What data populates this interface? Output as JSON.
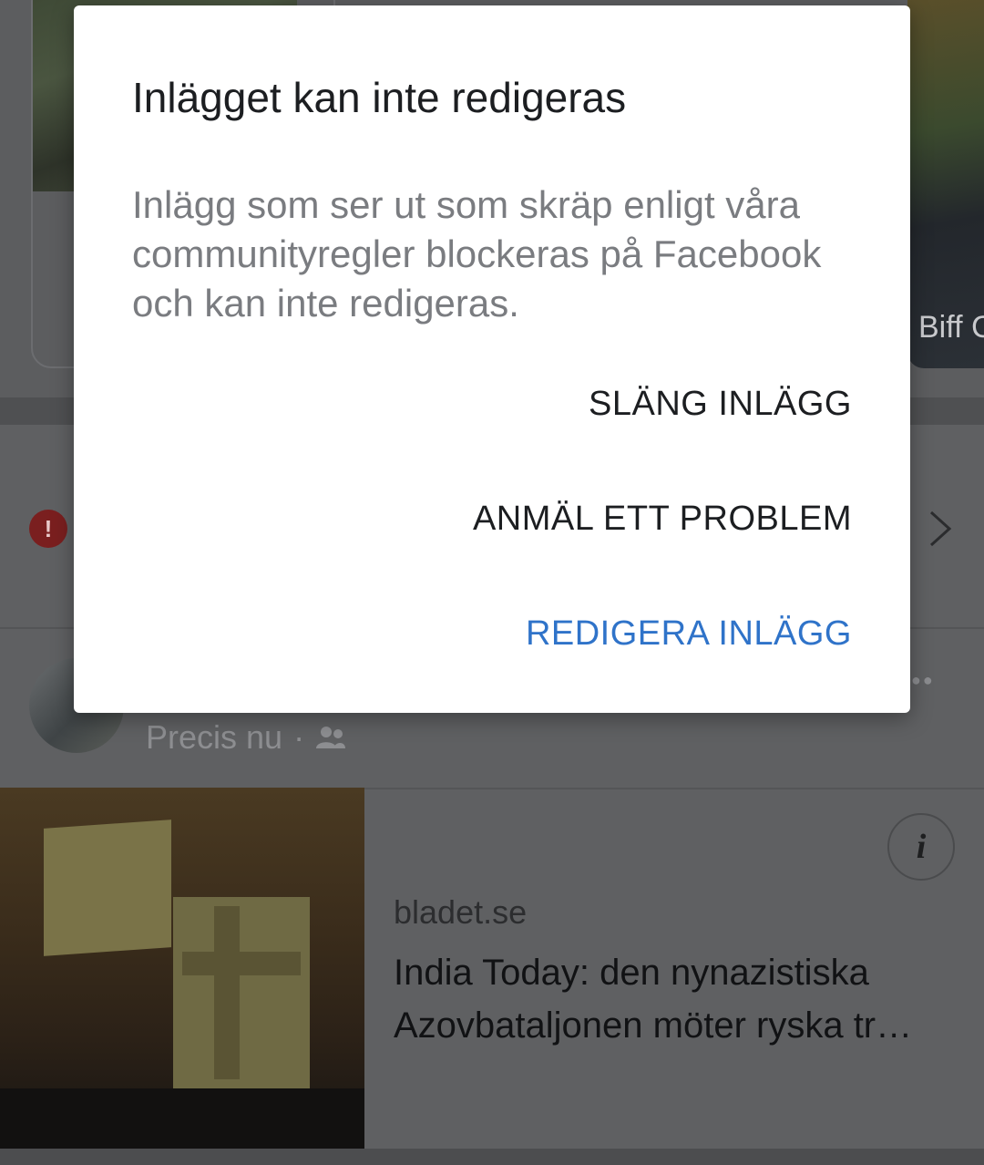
{
  "background": {
    "story_right_label": "Biff C",
    "post": {
      "timestamp": "Precis nu",
      "separator": "·",
      "audience_icon": "group-icon",
      "more_icon": "more-dots-icon"
    },
    "link_card": {
      "domain": "bladet.se",
      "title": "India Today: den nynazistiska Azovbataljonen möter ryska tr…",
      "info_icon": "info-icon"
    },
    "alert_icon": "exclamation-icon",
    "chevron_icon": "chevron-right-icon"
  },
  "dialog": {
    "title": "Inlägget kan inte redigeras",
    "body": "Inlägg som ser ut som skräp enligt våra communityregler blockeras på Facebook och kan inte redigeras.",
    "buttons": {
      "discard": "SLÄNG INLÄGG",
      "report": "ANMÄL ETT PROBLEM",
      "edit": "REDIGERA INLÄGG"
    },
    "colors": {
      "accent": "#2f73c9",
      "title": "#1c1e21",
      "body": "#7a7c80"
    }
  }
}
